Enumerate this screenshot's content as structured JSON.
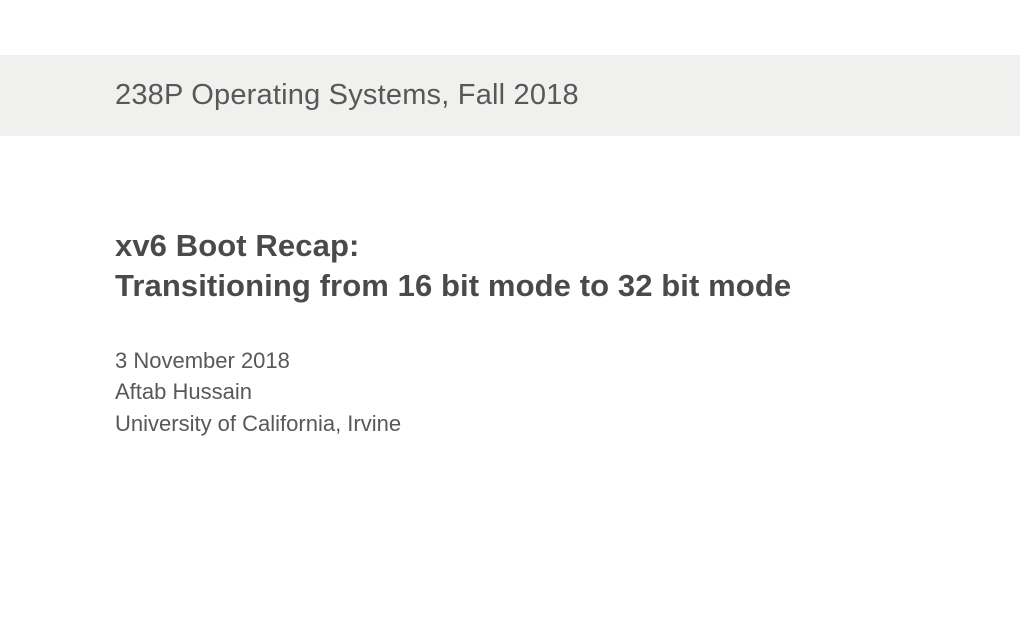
{
  "header": {
    "course_title": "238P Operating Systems,  Fall 2018"
  },
  "slide": {
    "title_line1": "xv6 Boot Recap:",
    "title_line2": "Transitioning from 16 bit mode to 32 bit mode",
    "date": "3 November 2018",
    "author": "Aftab Hussain",
    "affiliation": "University of California, Irvine"
  }
}
